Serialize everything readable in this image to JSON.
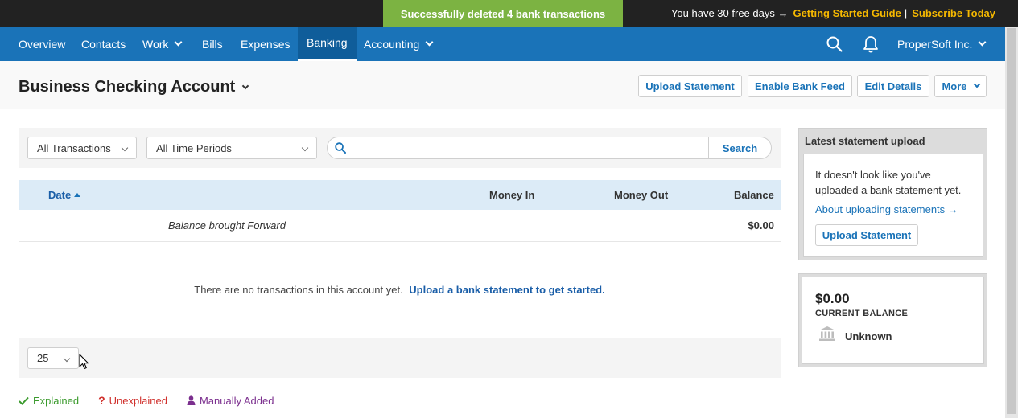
{
  "toast": "Successfully deleted 4 bank transactions",
  "trial": {
    "text": "You have 30 free days →",
    "guide_link": "Getting Started Guide",
    "separator": "|",
    "subscribe_link": "Subscribe Today"
  },
  "nav": {
    "items": [
      {
        "label": "Overview"
      },
      {
        "label": "Contacts"
      },
      {
        "label": "Work",
        "dropdown": true
      },
      {
        "label": "Bills"
      },
      {
        "label": "Expenses"
      },
      {
        "label": "Banking",
        "active": true
      },
      {
        "label": "Accounting",
        "dropdown": true
      }
    ],
    "search_icon": "search-icon",
    "bell_icon": "bell-icon",
    "company": "ProperSoft Inc."
  },
  "header": {
    "title": "Business Checking Account",
    "buttons": {
      "upload": "Upload Statement",
      "bank_feed": "Enable Bank Feed",
      "edit": "Edit Details",
      "more": "More"
    }
  },
  "filters": {
    "transactions": "All Transactions",
    "periods": "All Time Periods",
    "search_placeholder": "",
    "search_button": "Search"
  },
  "table": {
    "columns": {
      "date": "Date",
      "money_in": "Money In",
      "money_out": "Money Out",
      "balance": "Balance"
    },
    "rows": [
      {
        "description": "Balance brought Forward",
        "balance": "$0.00"
      }
    ],
    "empty_text": "There are no transactions in this account yet.",
    "empty_link": "Upload a bank statement to get started."
  },
  "pager": {
    "page_size": "25"
  },
  "legend": {
    "explained": "Explained",
    "unexplained": "Unexplained",
    "manually_added": "Manually Added",
    "colors": {
      "explained": "#3a9a2c",
      "unexplained": "#d0312d",
      "manually_added": "#7b2f8e"
    }
  },
  "statement_card": {
    "title": "Latest statement upload",
    "message": "It doesn't look like you've uploaded a bank statement yet.",
    "link": "About uploading statements →",
    "button": "Upload Statement"
  },
  "balance_card": {
    "amount": "$0.00",
    "label": "CURRENT BALANCE",
    "bank": "Unknown"
  },
  "colors": {
    "nav_bg": "#1a73b8",
    "accent": "#1a73b8",
    "toast_bg": "#7cb342",
    "topbar_bg": "#222222",
    "trial_link": "#f5b800"
  }
}
